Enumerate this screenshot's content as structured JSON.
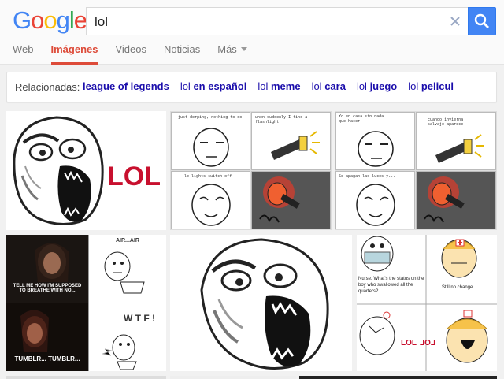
{
  "logo": {
    "letters": [
      "G",
      "o",
      "o",
      "g",
      "l",
      "e"
    ],
    "colors": [
      "#4285f4",
      "#ea4335",
      "#fbbc05",
      "#4285f4",
      "#34a853",
      "#ea4335"
    ]
  },
  "search": {
    "value": "lol"
  },
  "nav": {
    "web": "Web",
    "images": "Imágenes",
    "videos": "Videos",
    "news": "Noticias",
    "more": "Más"
  },
  "related": {
    "label": "Relacionadas:",
    "items": [
      {
        "prefix": "",
        "bold": "league of legends"
      },
      {
        "prefix": "lol ",
        "bold": "en español"
      },
      {
        "prefix": "lol ",
        "bold": "meme"
      },
      {
        "prefix": "lol ",
        "bold": "cara"
      },
      {
        "prefix": "lol ",
        "bold": "juego"
      },
      {
        "prefix": "lol ",
        "bold": "pelicul"
      }
    ]
  },
  "results": {
    "r1_lol": "LOL",
    "r2_cap1": "just derping, nothing to do",
    "r2_cap2": "when suddenly I find a flashlight",
    "r2_cap3": "le lights switch off",
    "r3_cap1": "Yo en casa sin nada que hacer",
    "r3_cap2": "cuando invierna salvaje aparece",
    "r3_cap3": "Se apagan las luces y...",
    "r4_top": "AIR...AIR",
    "r4_caption": "TELL ME HOW I'M SUPPOSED TO BREATHE WITH NO...",
    "r4_wtf": "W T F !",
    "r4_bottom": "TUMBLR... TUMBLR...",
    "r6_nurse": "Nurse. What's the status on the boy who swallowed all the quarters?",
    "r6_reply": "Still no change.",
    "r6_lol": "LOL",
    "r6_lol_rev": "LOL"
  },
  "colors": {
    "accent_red": "#dd4b39",
    "link_blue": "#1a0dab",
    "search_blue": "#4285f4",
    "lol_red": "#c8102e"
  }
}
